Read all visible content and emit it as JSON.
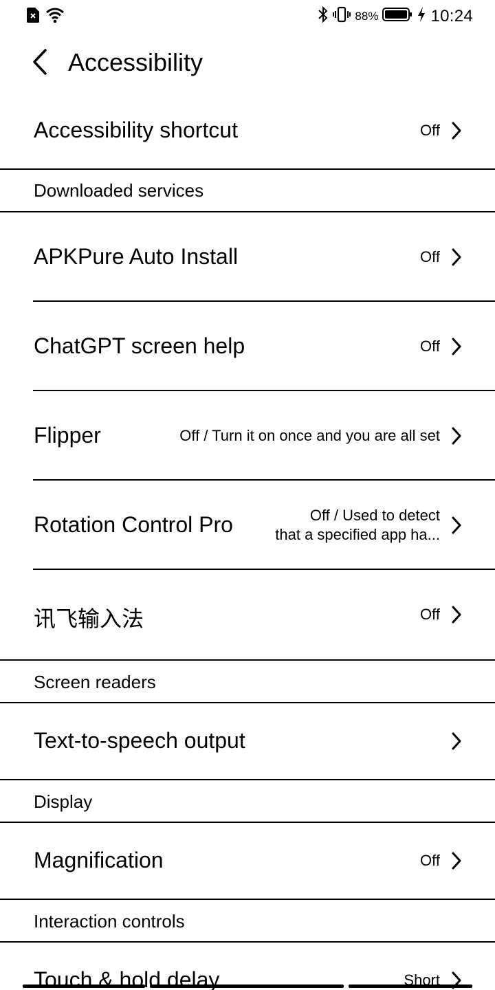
{
  "status_bar": {
    "battery_percent": "88%",
    "time": "10:24"
  },
  "header": {
    "title": "Accessibility"
  },
  "rows": {
    "accessibility_shortcut": {
      "label": "Accessibility shortcut",
      "value": "Off"
    },
    "apkpure": {
      "label": "APKPure Auto Install",
      "value": "Off"
    },
    "chatgpt": {
      "label": "ChatGPT screen help",
      "value": "Off"
    },
    "flipper": {
      "label": "Flipper",
      "value": "Off / Turn it on once and you are all set"
    },
    "rotation": {
      "label": "Rotation Control Pro",
      "value_line1": "Off / Used to detect",
      "value_line2": "that a specified app ha..."
    },
    "xunfei": {
      "label": "讯飞输入法",
      "value": "Off"
    },
    "tts": {
      "label": "Text-to-speech output"
    },
    "magnification": {
      "label": "Magnification",
      "value": "Off"
    },
    "touch_hold": {
      "label": "Touch & hold delay",
      "value": "Short"
    }
  },
  "sections": {
    "downloaded": "Downloaded services",
    "screen_readers": "Screen readers",
    "display": "Display",
    "interaction": "Interaction controls"
  },
  "icons": [
    "sim-off-icon",
    "wifi-icon",
    "bluetooth-icon",
    "vibrate-icon",
    "battery-icon",
    "charging-icon",
    "back-arrow-icon",
    "chevron-right-icon"
  ]
}
